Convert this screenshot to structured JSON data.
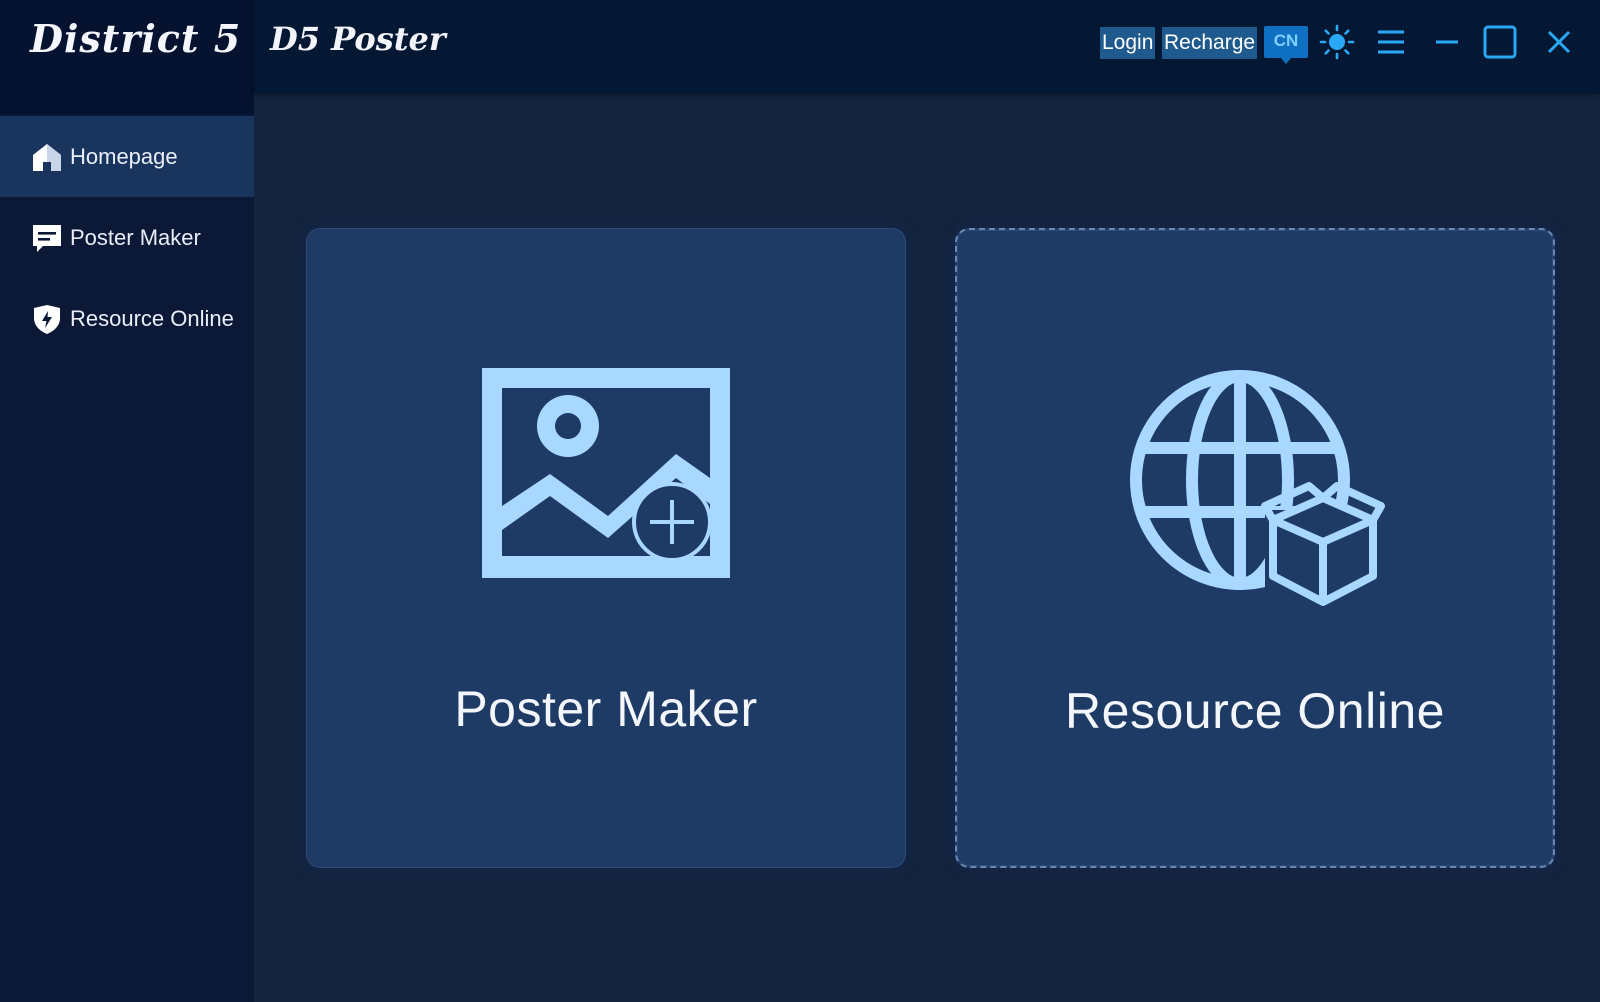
{
  "brand": {
    "name": "District 5"
  },
  "titlebar": {
    "title": "D5 Poster",
    "login_label": "Login",
    "recharge_label": "Recharge",
    "language_label": "CN",
    "icons": [
      "sun-icon",
      "menu-icon",
      "minimize-icon",
      "maximize-icon",
      "close-icon"
    ]
  },
  "sidebar": {
    "items": [
      {
        "label": "Homepage",
        "icon": "home-icon",
        "active": true
      },
      {
        "label": "Poster Maker",
        "icon": "message-icon",
        "active": false
      },
      {
        "label": "Resource Online",
        "icon": "shield-icon",
        "active": false
      }
    ]
  },
  "main": {
    "cards": [
      {
        "label": "Poster Maker",
        "icon": "add-image-icon"
      },
      {
        "label": "Resource Online",
        "icon": "globe-box-icon"
      }
    ]
  },
  "colors": {
    "accent": "#1f5a8e",
    "icon": "#a8d8ff",
    "card": "#1e3b66",
    "sidebar": "#0b1836"
  }
}
